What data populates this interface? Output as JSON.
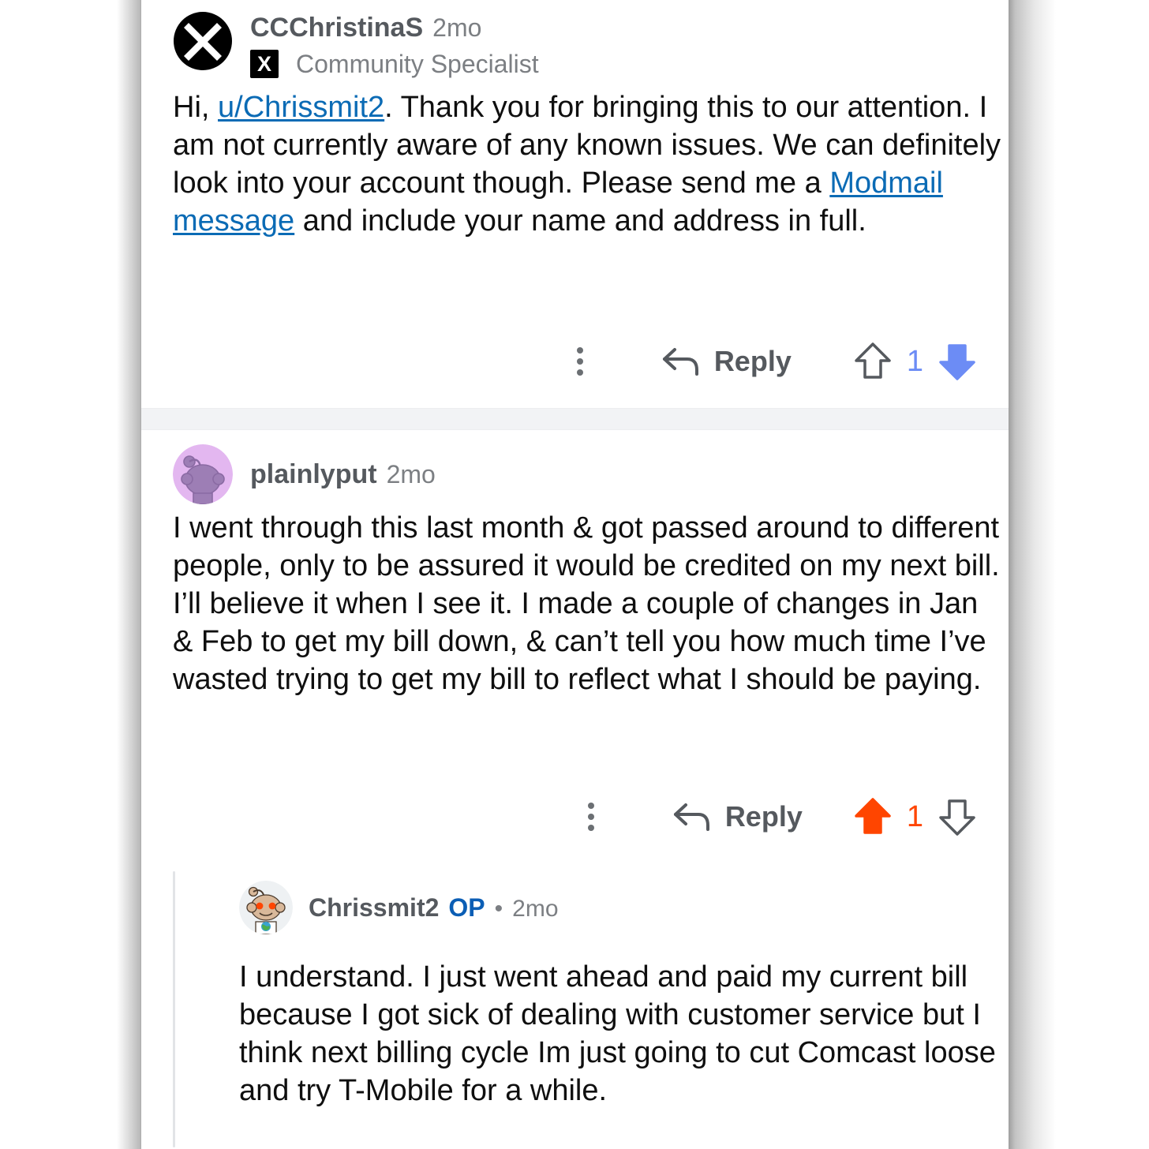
{
  "theme": {
    "page_background": "#ffffff",
    "card_background": "#ffffff",
    "link_color": "#0b6bb5",
    "op_badge_color": "#0b5eb5",
    "meta_text_color": "#7c7f83",
    "username_color": "#55595e",
    "body_text_color": "#0f0f0f",
    "upvote_active_color": "#ff4500",
    "downvote_active_color": "#6c8cf5",
    "vote_outline_color": "#55595e",
    "divider_color": "#f2f3f5",
    "threadline_color": "#e2e4e7"
  },
  "comments": [
    {
      "id": "comment-1",
      "author": "CCChristinaS",
      "timestamp": "2mo",
      "avatar_icon": "xfinity-x-avatar",
      "flair": {
        "icon": "xfinity-x-flair-icon",
        "icon_glyph": "X",
        "label": "Community Specialist"
      },
      "body_parts": [
        {
          "type": "text",
          "value": "Hi, "
        },
        {
          "type": "link",
          "value": "u/Chrissmit2"
        },
        {
          "type": "text",
          "value": ". Thank you for bringing this to our attention. I am not currently aware of any known issues. We can definitely look into your account though. Please send me a "
        },
        {
          "type": "link",
          "value": "Modmail message"
        },
        {
          "type": "text",
          "value": " and include your name and address in full."
        }
      ],
      "actions": {
        "more_label": "more-options",
        "reply_label": "Reply",
        "score": "1",
        "vote_state": "downvoted"
      }
    },
    {
      "id": "comment-2",
      "author": "plainlyput",
      "timestamp": "2mo",
      "avatar_icon": "snoo-purple-avatar",
      "body_parts": [
        {
          "type": "text",
          "value": "I went through this last month & got passed around to different people, only to be assured it would be credited on my next bill. I’ll believe it when I see it. I made a couple of changes in Jan &  Feb to get my bill down, & can’t tell you how much time I’ve wasted trying to get my bill to reflect what I should be paying."
        }
      ],
      "actions": {
        "more_label": "more-options",
        "reply_label": "Reply",
        "score": "1",
        "vote_state": "upvoted"
      },
      "replies": [
        {
          "id": "reply-1",
          "author": "Chrissmit2",
          "op_badge": "OP",
          "separator": "•",
          "timestamp": "2mo",
          "avatar_icon": "snoo-tan-avatar",
          "body_parts": [
            {
              "type": "text",
              "value": "I understand. I just went ahead and paid my current bill because I got sick of dealing with customer service but I think next billing cycle Im just going to cut Comcast loose and try T-Mobile for a while."
            }
          ]
        }
      ]
    }
  ]
}
